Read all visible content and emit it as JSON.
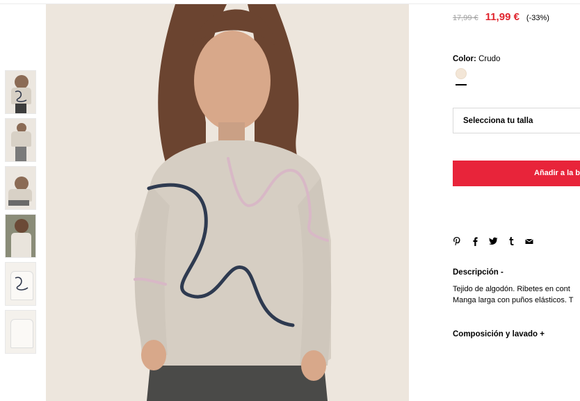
{
  "product": {
    "old_price": "17,99 €",
    "new_price": "11,99 €",
    "discount": "(-33%)",
    "color_label": "Color:",
    "color_value": "Crudo",
    "swatch_color": "#f3e6d7",
    "size_placeholder": "Selecciona tu talla",
    "add_button": "Añadir a la b",
    "description_title": "Descripción -",
    "description_lines": [
      "Tejido de algodón. Ribetes en cont",
      "Manga larga con puños elásticos. T"
    ],
    "composition_title": "Composición y lavado +"
  },
  "share_icons": [
    "pinterest-icon",
    "facebook-icon",
    "twitter-icon",
    "tumblr-icon",
    "email-icon"
  ],
  "colors": {
    "sale_red": "#e0262f",
    "button_red": "#e8243a",
    "image_bg": "#ede6dd"
  }
}
